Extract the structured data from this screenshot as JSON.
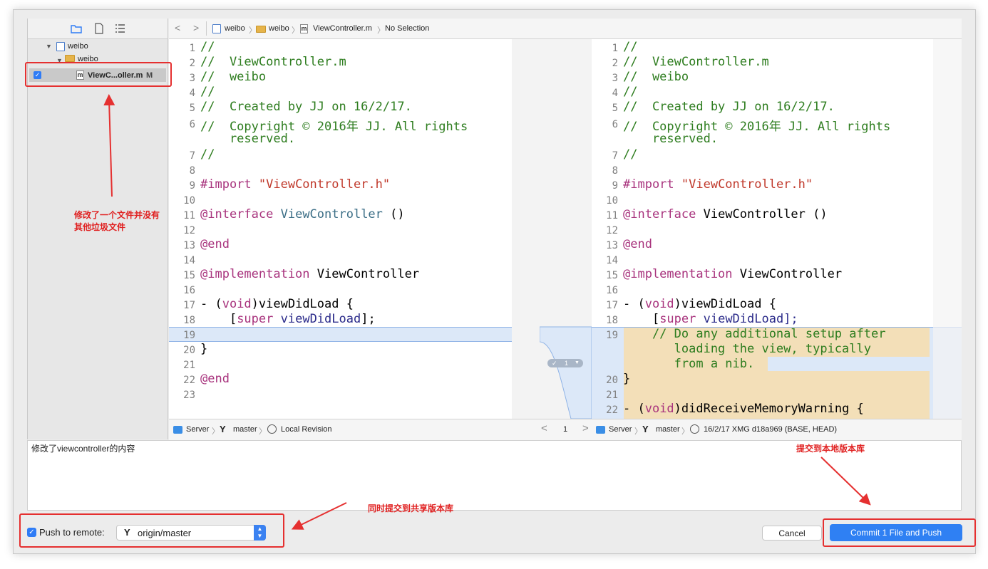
{
  "navigator": {
    "root": "weibo",
    "group": "weibo",
    "file": "ViewC...oller.m",
    "file_status": "M"
  },
  "jumpbar": {
    "crumbs": [
      "weibo",
      "weibo",
      "ViewController.m",
      "No Selection"
    ]
  },
  "left_code": {
    "line_numbers": [
      "1",
      "2",
      "3",
      "4",
      "5",
      "6",
      "7",
      "8",
      "9",
      "10",
      "11",
      "12",
      "13",
      "14",
      "15",
      "16",
      "17",
      "18",
      "19",
      "20",
      "21",
      "22",
      "23"
    ],
    "lines": {
      "l1": "//",
      "l2": "//  ViewController.m",
      "l3": "//  weibo",
      "l4": "//",
      "l5": "//  Created by JJ on 16/2/17.",
      "l6": "//  Copyright © 2016年 JJ. All rights",
      "l6b": "    reserved.",
      "l7": "//",
      "l9a": "#import ",
      "l9b": "\"ViewController.h\"",
      "l11a": "@interface",
      "l11b": " ",
      "l11c": "ViewController",
      "l11d": " ()",
      "l13": "@end",
      "l15a": "@implementation",
      "l15b": " ViewController",
      "l17a": "- (",
      "l17b": "void",
      "l17c": ")viewDidLoad {",
      "l18a": "    [",
      "l18b": "super",
      "l18c": " ",
      "l18d": "viewDidLoad",
      "l18e": "];",
      "l20": "}",
      "l22": "@end"
    }
  },
  "right_code": {
    "line_numbers": [
      "1",
      "2",
      "3",
      "4",
      "5",
      "6",
      "7",
      "8",
      "9",
      "10",
      "11",
      "12",
      "13",
      "14",
      "15",
      "16",
      "17",
      "18",
      "19",
      "20",
      "21",
      "22"
    ],
    "lines": {
      "l1": "//",
      "l2": "//  ViewController.m",
      "l3": "//  weibo",
      "l4": "//",
      "l5": "//  Created by JJ on 16/2/17.",
      "l6": "//  Copyright © 2016年 JJ. All rights",
      "l6b": "    reserved.",
      "l7": "//",
      "l9a": "#import ",
      "l9b": "\"ViewController.h\"",
      "l11a": "@interface",
      "l11b": " ViewController ()",
      "l13": "@end",
      "l15a": "@implementation",
      "l15b": " ViewController",
      "l17a": "- (",
      "l17b": "void",
      "l17c": ")viewDidLoad {",
      "l18a": "    [",
      "l18b": "super",
      "l18c": " viewDidLoad];",
      "l19a": "    // Do any additional setup after",
      "l19b": "       loading the view, typically",
      "l19c": "       from a nib.",
      "l20": "}",
      "l22a": "- (",
      "l22b": "void",
      "l22c": ")didReceiveMemoryWarning {"
    }
  },
  "change_badge": "1",
  "status_left": {
    "server": "Server",
    "branch": "master",
    "revision": "Local Revision"
  },
  "status_mid": {
    "page": "1"
  },
  "status_right": {
    "server": "Server",
    "branch": "master",
    "revision": "16/2/17  XMG  d18a969 (BASE, HEAD)"
  },
  "commit_message": "修改了viewcontroller的内容",
  "push": {
    "checkbox_label": "Push to remote:",
    "remote": "origin/master",
    "checked": true
  },
  "buttons": {
    "cancel": "Cancel",
    "commit": "Commit 1 File and Push"
  },
  "annotations": {
    "nav_note_1": "修改了一个文件并没有",
    "nav_note_2": "其他垃圾文件",
    "commit_note": "提交到本地版本库",
    "push_note": "同时提交到共享版本库"
  },
  "colors": {
    "accent": "#3b82f1",
    "annotation": "#e02020",
    "comment": "#2e7d1f",
    "keyword": "#a8337d",
    "string": "#c0392b"
  }
}
